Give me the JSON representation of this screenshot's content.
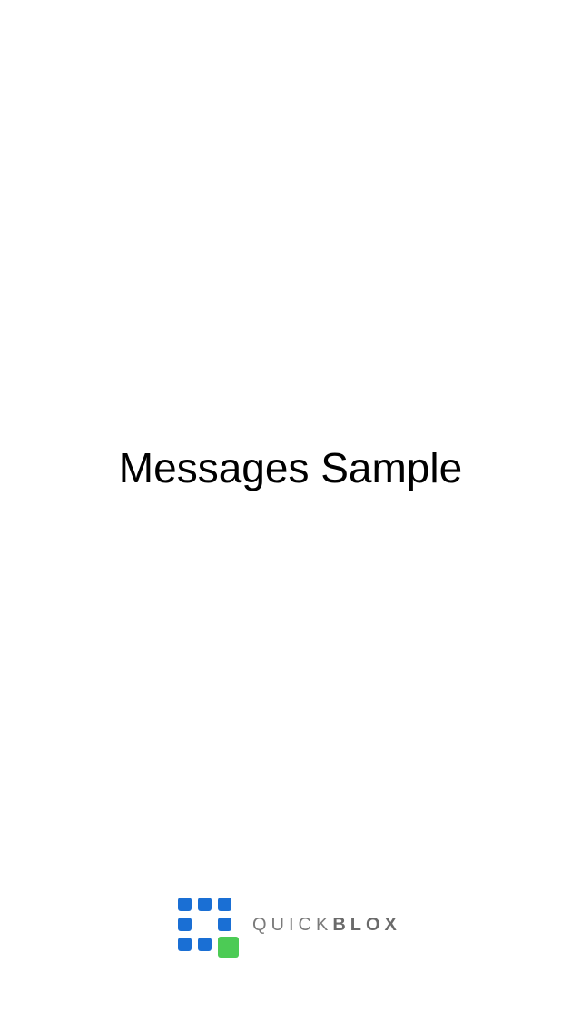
{
  "splash": {
    "title": "Messages Sample"
  },
  "brand": {
    "word_light": "QUICK",
    "word_bold": "BLOX",
    "icon": "quickblox-logo-icon",
    "colors": {
      "blue": "#1a6fd4",
      "green": "#4ccb55",
      "wordmark": "#7a7a7a"
    }
  }
}
